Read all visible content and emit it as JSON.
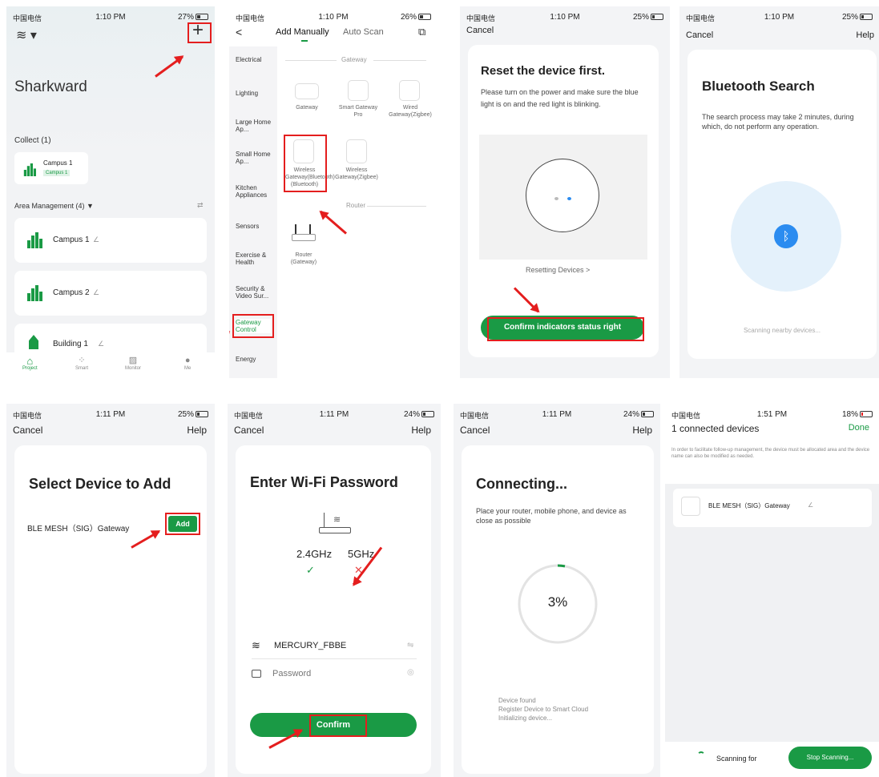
{
  "status": [
    {
      "carrier": "中国电信",
      "time": "1:10 PM",
      "batt": "27%"
    },
    {
      "carrier": "中国电信",
      "time": "1:10 PM",
      "batt": "26%"
    },
    {
      "carrier": "中国电信",
      "time": "1:10 PM",
      "batt": "25%"
    },
    {
      "carrier": "中国电信",
      "time": "1:10 PM",
      "batt": "25%"
    },
    {
      "carrier": "中国电信",
      "time": "1:11 PM",
      "batt": "25%"
    },
    {
      "carrier": "中国电信",
      "time": "1:11 PM",
      "batt": "24%"
    },
    {
      "carrier": "中国电信",
      "time": "1:11 PM",
      "batt": "24%"
    },
    {
      "carrier": "中国电信",
      "time": "1:51 PM",
      "batt": "18%"
    }
  ],
  "s1": {
    "add": "+",
    "title": "Sharkward",
    "collect": "Collect  (1)",
    "collect_item": "Campus 1",
    "collect_badge": "Campus 1",
    "area": "Area Management (4)",
    "areas": [
      "Campus 1",
      "Campus 2",
      "Building 1"
    ],
    "tabs": [
      "Project",
      "Smart",
      "Monitor",
      "Me"
    ]
  },
  "s2": {
    "back": "<",
    "tab_manual": "Add Manually",
    "tab_auto": "Auto Scan",
    "cats": [
      "Electrical",
      "Lighting",
      "Large Home Ap...",
      "Small Home Ap...",
      "Kitchen Appliances",
      "Sensors",
      "Exercise & Health",
      "Security & Video Sur...",
      "Gateway Control",
      "Energy"
    ],
    "sec_gateway": "Gateway",
    "sec_router": "Router",
    "devices": [
      "Gateway",
      "Smart Gateway Pro",
      "Wired Gateway(Zigbee)",
      "Wireless Gateway(Bluetooth)(Bluetooth)",
      "Wireless Gateway(Zigbee)",
      "Router (Gateway)"
    ]
  },
  "s3": {
    "cancel": "Cancel",
    "title": "Reset the device first.",
    "body": "Please turn on the power and make sure the blue light is on and the red light is blinking.",
    "link": "Resetting Devices >",
    "btn": "Confirm indicators status right"
  },
  "s4": {
    "cancel": "Cancel",
    "help": "Help",
    "title": "Bluetooth Search",
    "body": "The search process may take 2 minutes, during which, do not perform any operation.",
    "scan": "Scanning nearby devices..."
  },
  "s5": {
    "cancel": "Cancel",
    "help": "Help",
    "title": "Select Device to Add",
    "device": "BLE MESH（SIG）Gateway",
    "add": "Add"
  },
  "s6": {
    "cancel": "Cancel",
    "help": "Help",
    "title": "Enter Wi-Fi Password",
    "b24": "2.4GHz",
    "b5": "5GHz",
    "ssid": "MERCURY_FBBE",
    "pw_placeholder": "Password",
    "confirm": "Confirm"
  },
  "s7": {
    "cancel": "Cancel",
    "help": "Help",
    "title": "Connecting...",
    "body": "Place your router, mobile phone, and device as close as possible",
    "pct": "3%",
    "pct_value": 3,
    "log": [
      "Device found",
      "Register Device to Smart Cloud",
      "Initializing device..."
    ]
  },
  "s8": {
    "title": "1 connected devices",
    "done": "Done",
    "note": "In order to facilitate follow-up management, the device must be allocated area and the device name can also be modified as needed.",
    "device": "BLE MESH（SIG）Gateway",
    "scanning": "Scanning for",
    "stop": "Stop Scanning..."
  },
  "colors": {
    "accent": "#1a9a45",
    "mark": "#e41e1e",
    "bt": "#2b8cf0"
  }
}
